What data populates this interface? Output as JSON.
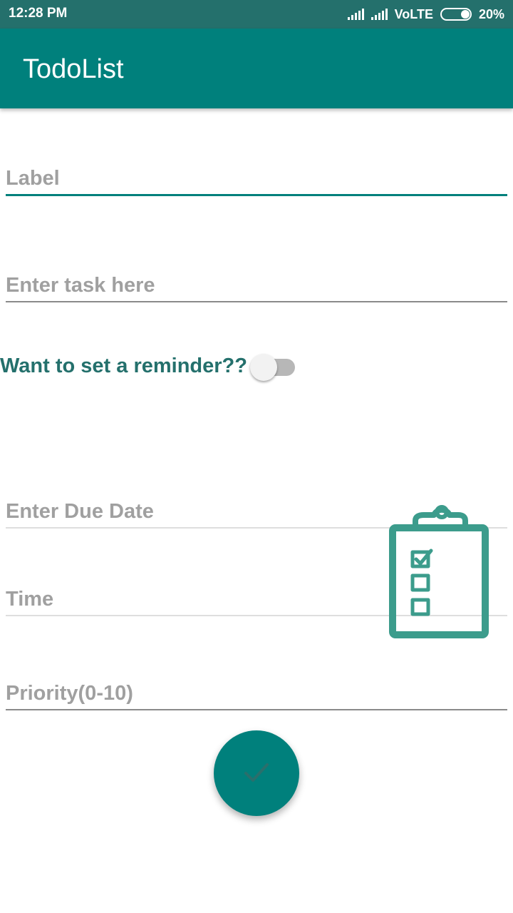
{
  "status_bar": {
    "time": "12:28 PM",
    "network": "VoLTE",
    "battery": "20%"
  },
  "app_bar": {
    "title": "TodoList"
  },
  "form": {
    "label_placeholder": "Label",
    "task_placeholder": "Enter task here",
    "reminder_label": "Want to set a reminder??",
    "reminder_on": false,
    "due_date_placeholder": "Enter Due Date",
    "time_placeholder": "Time",
    "priority_placeholder": "Priority(0-10)"
  },
  "icons": {
    "clipboard": "clipboard-checklist-icon",
    "fab": "checkmark-icon"
  },
  "colors": {
    "status_bar": "#24706c",
    "primary": "#00807c",
    "accent_text": "#24706c",
    "clipboard": "#3c9c8c"
  }
}
